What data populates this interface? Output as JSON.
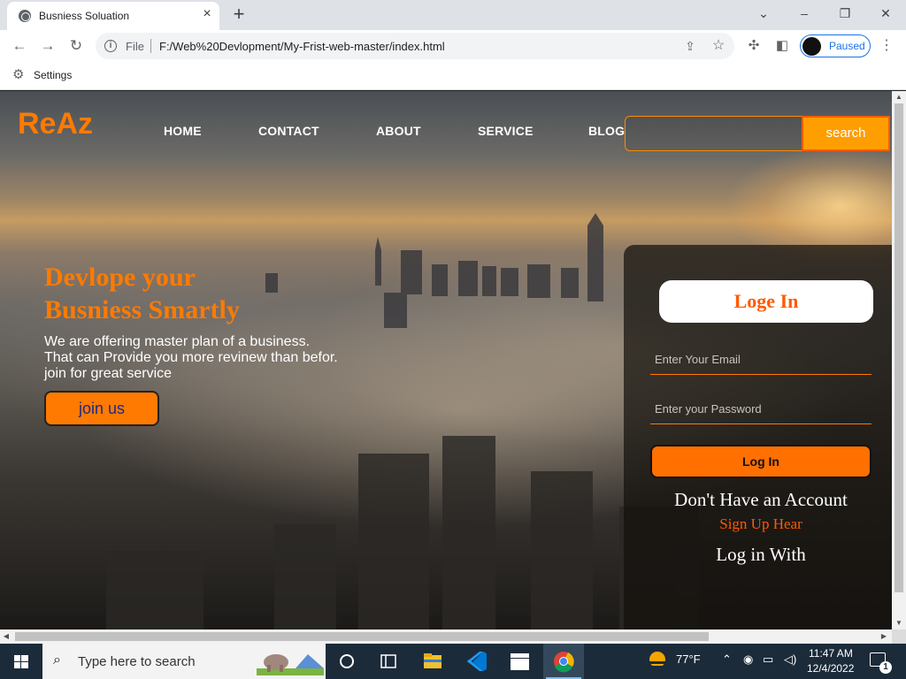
{
  "browser": {
    "tab_title": "Busniess Soluation",
    "url_scheme": "File",
    "url": "F:/Web%20Devlopment/My-Frist-web-master/index.html",
    "profile_status": "Paused",
    "bookmark_label": "Settings"
  },
  "site": {
    "brand": "ReAz",
    "nav": [
      "HOME",
      "CONTACT",
      "ABOUT",
      "SERVICE",
      "BLOG"
    ],
    "search_placeholder": "",
    "search_button": "search",
    "hero": {
      "title_line1": "Devlope your",
      "title_line2": "Busniess Smartly",
      "text_line1": "We are offering master plan of a business.",
      "text_line2": "That can Provide you more revinew than befor.",
      "text_line3": "join for great service",
      "cta": "join us"
    },
    "login": {
      "title": "Loge In",
      "email_placeholder": "Enter Your Email",
      "password_placeholder": "Enter your Password",
      "button": "Log In",
      "no_account": "Don't Have an Account",
      "signup": "Sign Up Hear",
      "login_with": "Log in With"
    }
  },
  "taskbar": {
    "search_placeholder": "Type here to search",
    "weather": "77°F",
    "time": "11:47 AM",
    "date": "12/4/2022",
    "notification_count": "1"
  },
  "colors": {
    "accent": "#ff7a00",
    "chrome_tabstrip": "#dee1e6",
    "taskbar": "#1c2b3a",
    "profile_blue": "#1a73e8"
  }
}
